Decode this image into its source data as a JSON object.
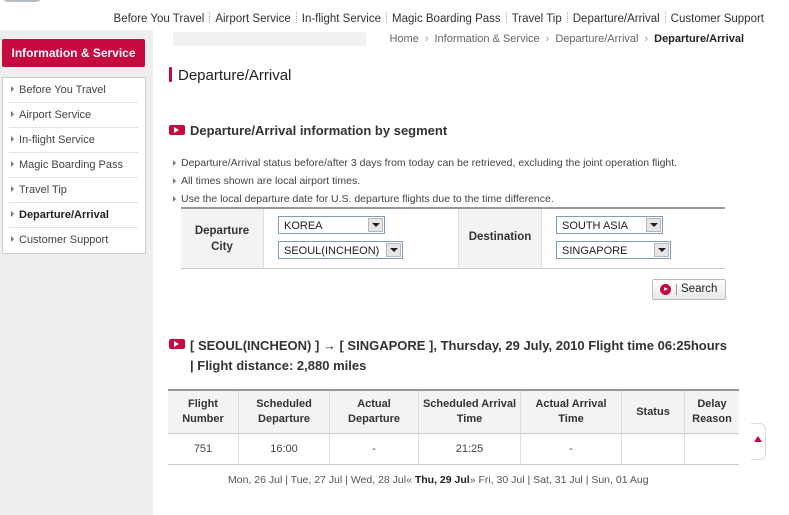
{
  "top_nav": {
    "links": [
      "Before You Travel",
      "Airport Service",
      "In-flight Service",
      "Magic Boarding Pass",
      "Travel Tip",
      "Departure/Arrival",
      "Customer Support"
    ]
  },
  "sidebar": {
    "title": "Information & Service",
    "items": [
      {
        "label": "Before You Travel"
      },
      {
        "label": "Airport Service"
      },
      {
        "label": "In-flight Service"
      },
      {
        "label": "Magic Boarding Pass"
      },
      {
        "label": "Travel Tip"
      },
      {
        "label": "Departure/Arrival"
      },
      {
        "label": "Customer Support"
      }
    ],
    "active_index": 5
  },
  "breadcrumb": {
    "items": [
      "Home",
      "Information & Service",
      "Departure/Arrival"
    ],
    "current": "Departure/Arrival"
  },
  "page_title": "Departure/Arrival",
  "section_title": "Departure/Arrival information by segment",
  "notes": [
    "Departure/Arrival status before/after 3 days from today can be retrieved, excluding the joint operation flight.",
    "All times shown are local airport times.",
    "Use the local departure date for U.S. departure flights due to the time difference."
  ],
  "form": {
    "departure_label": "Departure City",
    "departure_region": "KOREA",
    "departure_city": "SEOUL(INCHEON)",
    "destination_label": "Destination",
    "destination_region": "SOUTH ASIA",
    "destination_city": "SINGAPORE",
    "search_label": "Search"
  },
  "route_title": "[ SEOUL(INCHEON) ] → [ SINGAPORE ], Thursday, 29 July, 2010 Flight time 06:25hours | Flight distance: 2,880 miles",
  "results": {
    "headers": [
      "Flight Number",
      "Scheduled Departure",
      "Actual Departure",
      "Scheduled Arrival Time",
      "Actual Arrival Time",
      "Status",
      "Delay Reason"
    ],
    "rows": [
      [
        "751",
        "16:00",
        "-",
        "21:25",
        "-",
        "",
        ""
      ]
    ]
  },
  "date_nav": {
    "before": [
      "Mon, 26 Jul",
      "Tue, 27 Jul",
      "Wed, 28 Jul"
    ],
    "current": "Thu, 29 Jul",
    "after": [
      "Fri, 30 Jul",
      "Sat, 31 Jul",
      "Sun, 01 Aug"
    ],
    "prev_marker": "«",
    "next_marker": "»",
    "separator": "|"
  },
  "colors": {
    "accent": "#c8093f",
    "sidebar_bg": "#eeeeee",
    "header_bg": "#f3f3f3"
  },
  "icons": [
    "arrow-bullet-icon",
    "play-icon",
    "chevron-down-icon",
    "scroll-up-icon"
  ]
}
